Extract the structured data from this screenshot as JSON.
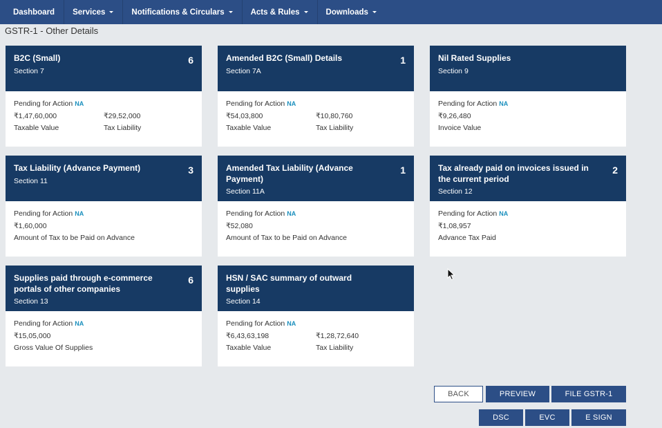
{
  "nav": {
    "items": [
      {
        "label": "Dashboard",
        "dropdown": false
      },
      {
        "label": "Services",
        "dropdown": true
      },
      {
        "label": "Notifications & Circulars",
        "dropdown": true
      },
      {
        "label": "Acts & Rules",
        "dropdown": true
      },
      {
        "label": "Downloads",
        "dropdown": true
      }
    ]
  },
  "page": {
    "title": "GSTR-1 - Other Details"
  },
  "cards": [
    {
      "title": "B2C (Small)",
      "section": "Section 7",
      "count": "6",
      "pending_label": "Pending for Action",
      "pending_status": "NA",
      "values": [
        {
          "amount": "₹1,47,60,000",
          "label": "Taxable Value"
        },
        {
          "amount": "₹29,52,000",
          "label": "Tax Liability"
        }
      ]
    },
    {
      "title": "Amended B2C (Small) Details",
      "section": "Section 7A",
      "count": "1",
      "pending_label": "Pending for Action",
      "pending_status": "NA",
      "values": [
        {
          "amount": "₹54,03,800",
          "label": "Taxable Value"
        },
        {
          "amount": "₹10,80,760",
          "label": "Tax Liability"
        }
      ]
    },
    {
      "title": "Nil Rated Supplies",
      "section": "Section 9",
      "count": "",
      "pending_label": "Pending for Action",
      "pending_status": "NA",
      "values": [
        {
          "amount": "₹9,26,480",
          "label": "Invoice Value"
        }
      ]
    },
    {
      "title": "Tax Liability (Advance Payment)",
      "section": "Section 11",
      "count": "3",
      "pending_label": "Pending for Action",
      "pending_status": "NA",
      "values": [
        {
          "amount": "₹1,60,000",
          "label": "Amount of Tax to be Paid on Advance"
        }
      ]
    },
    {
      "title": "Amended Tax Liability (Advance Payment)",
      "section": "Section 11A",
      "count": "1",
      "pending_label": "Pending for Action",
      "pending_status": "NA",
      "values": [
        {
          "amount": "₹52,080",
          "label": "Amount of Tax to be Paid on Advance"
        }
      ]
    },
    {
      "title": "Tax already paid on invoices issued in the current period",
      "section": "Section 12",
      "count": "2",
      "pending_label": "Pending for Action",
      "pending_status": "NA",
      "values": [
        {
          "amount": "₹1,08,957",
          "label": "Advance Tax Paid"
        }
      ]
    },
    {
      "title": "Supplies paid through e-commerce portals of other companies",
      "section": "Section 13",
      "count": "6",
      "pending_label": "Pending for Action",
      "pending_status": "NA",
      "values": [
        {
          "amount": "₹15,05,000",
          "label": "Gross Value Of Supplies"
        }
      ]
    },
    {
      "title": "HSN / SAC summary of outward supplies",
      "section": "Section 14",
      "count": "",
      "pending_label": "Pending for Action",
      "pending_status": "NA",
      "values": [
        {
          "amount": "₹6,43,63,198",
          "label": "Taxable Value"
        },
        {
          "amount": "₹1,28,72,640",
          "label": "Tax Liability"
        }
      ]
    }
  ],
  "actions": {
    "back": "BACK",
    "preview": "PREVIEW",
    "file": "FILE GSTR-1",
    "dsc": "DSC",
    "evc": "EVC",
    "esign": "E SIGN"
  },
  "colors": {
    "nav_bg": "#2c4e86",
    "card_header": "#173a64",
    "page_bg": "#e6e9ec",
    "na_accent": "#1a8fbd"
  }
}
